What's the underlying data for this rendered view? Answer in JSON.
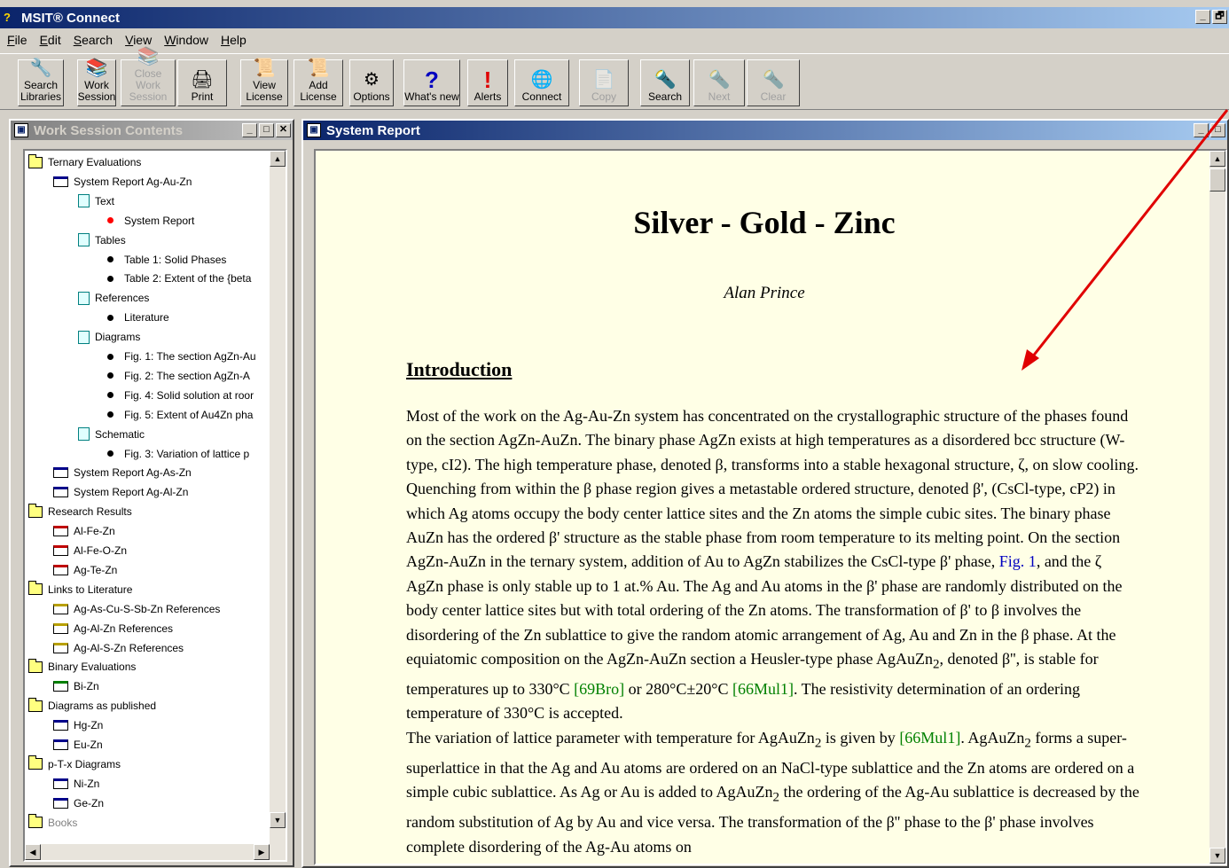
{
  "app": {
    "title": "MSIT® Connect",
    "window_controls": {
      "minimize": "_",
      "restore": "🗗"
    }
  },
  "menu": [
    "File",
    "Edit",
    "Search",
    "View",
    "Window",
    "Help"
  ],
  "toolbar": [
    {
      "id": "search-libraries",
      "label1": "Search",
      "label2": "Libraries",
      "icon": "search-libraries-icon",
      "glyph": "🔧",
      "disabled": false
    },
    {
      "id": "work-session",
      "label1": "Work",
      "label2": "Session",
      "icon": "work-session-icon",
      "glyph": "📚",
      "disabled": false
    },
    {
      "id": "close-work-session",
      "label1": "Close Work",
      "label2": "Session",
      "icon": "close-session-icon",
      "glyph": "📚",
      "disabled": true
    },
    {
      "id": "print",
      "label1": "Print",
      "label2": "",
      "icon": "printer-icon",
      "glyph": "🖨",
      "disabled": false
    },
    {
      "id": "view-license",
      "label1": "View",
      "label2": "License",
      "icon": "license-icon",
      "glyph": "📜",
      "disabled": false
    },
    {
      "id": "add-license",
      "label1": "Add",
      "label2": "License",
      "icon": "add-license-icon",
      "glyph": "📜",
      "disabled": false
    },
    {
      "id": "options",
      "label1": "Options",
      "label2": "",
      "icon": "gears-icon",
      "glyph": "⚙",
      "disabled": false
    },
    {
      "id": "whats-new",
      "label1": "What's new",
      "label2": "",
      "icon": "question-icon",
      "glyph": "?",
      "disabled": false
    },
    {
      "id": "alerts",
      "label1": "Alerts",
      "label2": "",
      "icon": "exclamation-icon",
      "glyph": "!",
      "disabled": false
    },
    {
      "id": "connect",
      "label1": "Connect",
      "label2": "",
      "icon": "globe-icon",
      "glyph": "🌐",
      "disabled": false
    },
    {
      "id": "copy",
      "label1": "Copy",
      "label2": "",
      "icon": "copy-icon",
      "glyph": "📄",
      "disabled": true
    },
    {
      "id": "search",
      "label1": "Search",
      "label2": "",
      "icon": "flashlight-icon",
      "glyph": "🔦",
      "disabled": false
    },
    {
      "id": "next",
      "label1": "Next",
      "label2": "",
      "icon": "flashlight-icon",
      "glyph": "🔦",
      "disabled": true
    },
    {
      "id": "clear",
      "label1": "Clear",
      "label2": "",
      "icon": "flashlight-icon",
      "glyph": "🔦",
      "disabled": true
    }
  ],
  "left_pane": {
    "title": "Work Session Contents",
    "tree": [
      {
        "label": "Ternary Evaluations",
        "type": "folder",
        "level": 0
      },
      {
        "label": "System Report Ag-Au-Zn",
        "type": "report-blue",
        "level": 1
      },
      {
        "label": "Text",
        "type": "doc",
        "level": 2
      },
      {
        "label": "System Report",
        "type": "bullet-red",
        "level": 3
      },
      {
        "label": "Tables",
        "type": "doc",
        "level": 2
      },
      {
        "label": "Table 1: Solid Phases",
        "type": "bullet",
        "level": 3
      },
      {
        "label": "Table 2: Extent of the {beta",
        "type": "bullet",
        "level": 3
      },
      {
        "label": "References",
        "type": "doc",
        "level": 2
      },
      {
        "label": "Literature",
        "type": "bullet",
        "level": 3
      },
      {
        "label": "Diagrams",
        "type": "doc",
        "level": 2
      },
      {
        "label": "Fig. 1: The section AgZn-Au",
        "type": "bullet",
        "level": 3
      },
      {
        "label": "Fig. 2:  The section AgZn-A",
        "type": "bullet",
        "level": 3
      },
      {
        "label": "Fig. 4: Solid solution at roor",
        "type": "bullet",
        "level": 3
      },
      {
        "label": "Fig. 5: Extent of Au4Zn pha",
        "type": "bullet",
        "level": 3
      },
      {
        "label": "Schematic",
        "type": "doc",
        "level": 2
      },
      {
        "label": "Fig. 3: Variation of lattice p",
        "type": "bullet",
        "level": 3
      },
      {
        "label": "System Report Ag-As-Zn",
        "type": "report-blue",
        "level": 1
      },
      {
        "label": "System Report Ag-Al-Zn",
        "type": "report-blue",
        "level": 1
      },
      {
        "label": "Research  Results",
        "type": "folder",
        "level": 0
      },
      {
        "label": "Al-Fe-Zn",
        "type": "report-red",
        "level": 1
      },
      {
        "label": "Al-Fe-O-Zn",
        "type": "report-red",
        "level": 1
      },
      {
        "label": "Ag-Te-Zn",
        "type": "report-red",
        "level": 1
      },
      {
        "label": "Links to Literature",
        "type": "folder",
        "level": 0
      },
      {
        "label": "Ag-As-Cu-S-Sb-Zn References",
        "type": "report-yellow",
        "level": 1
      },
      {
        "label": "Ag-Al-Zn References",
        "type": "report-yellow",
        "level": 1
      },
      {
        "label": "Ag-Al-S-Zn References",
        "type": "report-yellow",
        "level": 1
      },
      {
        "label": "Binary  Evaluations",
        "type": "folder",
        "level": 0
      },
      {
        "label": "Bi-Zn",
        "type": "report-green",
        "level": 1
      },
      {
        "label": "Diagrams as published",
        "type": "folder",
        "level": 0
      },
      {
        "label": "Hg-Zn",
        "type": "report-blue",
        "level": 1
      },
      {
        "label": "Eu-Zn",
        "type": "report-blue",
        "level": 1
      },
      {
        "label": "p-T-x Diagrams",
        "type": "folder",
        "level": 0
      },
      {
        "label": "Ni-Zn",
        "type": "report-blue",
        "level": 1
      },
      {
        "label": "Ge-Zn",
        "type": "report-blue",
        "level": 1
      },
      {
        "label": "Books",
        "type": "folder-gray",
        "level": 0
      }
    ]
  },
  "right_pane": {
    "title": "System Report",
    "doc": {
      "title": "Silver - Gold - Zinc",
      "author": "Alan Prince",
      "heading": "Introduction"
    }
  },
  "colors": {
    "title_gradient_start": "#0a246a",
    "title_gradient_end": "#a6caf0",
    "doc_background": "#ffffe6",
    "link_blue": "#0000c0",
    "link_green": "#008000",
    "annotation_arrow": "#e00000"
  }
}
